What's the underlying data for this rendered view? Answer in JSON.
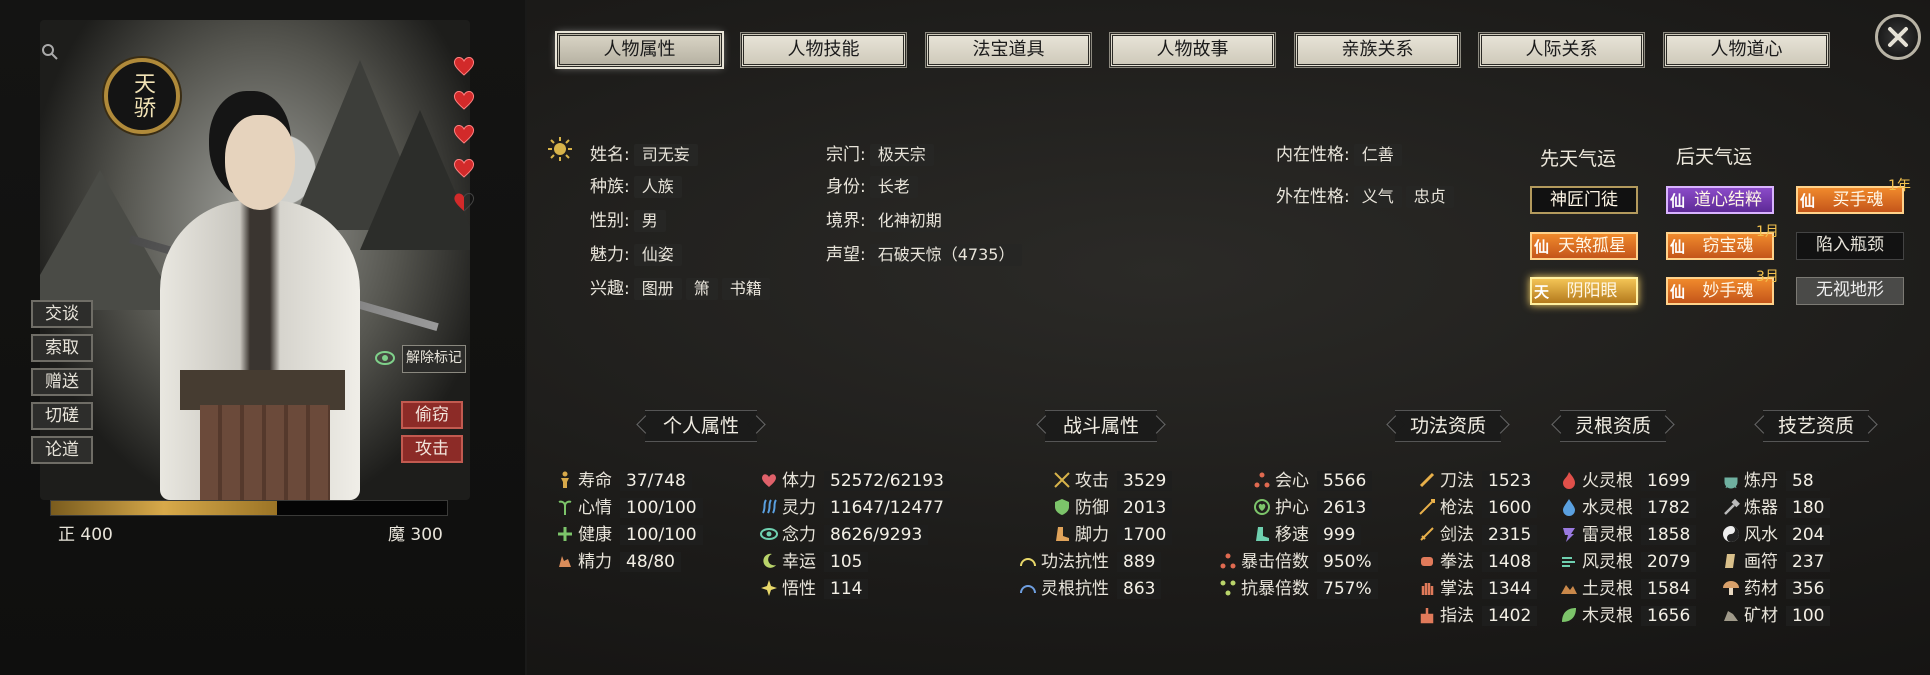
{
  "tabs": [
    "人物属性",
    "人物技能",
    "法宝道具",
    "人物故事",
    "亲族关系",
    "人际关系",
    "人物道心"
  ],
  "portrait": {
    "badge": "天骄",
    "side_buttons": [
      "交谈",
      "索取",
      "赠送",
      "切磋",
      "论道"
    ],
    "red_buttons": [
      "偷窃",
      "攻击"
    ],
    "unmark": "解除标记",
    "alignment": {
      "righteous": "正 400",
      "demonic": "魔 300",
      "righteous_value": 400,
      "demonic_value": 300
    }
  },
  "info": {
    "name_label": "姓名:",
    "name": "司无妄",
    "race_label": "种族:",
    "race": "人族",
    "gender_label": "性别:",
    "gender": "男",
    "charm_label": "魅力:",
    "charm": "仙姿",
    "hobby_label": "兴趣:",
    "hobbies": [
      "图册",
      "箫",
      "书籍"
    ],
    "sect_label": "宗门:",
    "sect": "极天宗",
    "identity_label": "身份:",
    "identity": "长老",
    "realm_label": "境界:",
    "realm": "化神初期",
    "fame_label": "声望:",
    "fame": "石破天惊（4735）",
    "inner_label": "内在性格:",
    "inner": "仁善",
    "outer_label": "外在性格:",
    "outer": [
      "义气",
      "忠贞"
    ]
  },
  "fortune": {
    "innate_head": "先天气运",
    "acquired_head": "后天气运",
    "innate": [
      "神匠门徒",
      "天煞孤星",
      "阴阳眼"
    ],
    "acquired": [
      "道心结粹",
      "窃宝魂",
      "妙手魂"
    ],
    "acquired_extra": [
      "买手魂",
      "陷入瓶颈",
      "无视地形"
    ],
    "tag_xian": "仙",
    "tag_tian": "天",
    "times": [
      "1年",
      "1月",
      "3月"
    ]
  },
  "sections": {
    "personal": "个人属性",
    "combat": "战斗属性",
    "technique": "功法资质",
    "root": "灵根资质",
    "skill": "技艺资质"
  },
  "personal_stats": [
    {
      "label": "寿命",
      "value": "37/748"
    },
    {
      "label": "心情",
      "value": "100/100"
    },
    {
      "label": "健康",
      "value": "100/100"
    },
    {
      "label": "精力",
      "value": "48/80"
    }
  ],
  "vital_stats": [
    {
      "label": "体力",
      "value": "52572/62193"
    },
    {
      "label": "灵力",
      "value": "11647/12477"
    },
    {
      "label": "念力",
      "value": "8626/9293"
    },
    {
      "label": "幸运",
      "value": "105"
    },
    {
      "label": "悟性",
      "value": "114"
    }
  ],
  "combat_stats": [
    {
      "label": "攻击",
      "value": "3529"
    },
    {
      "label": "防御",
      "value": "2013"
    },
    {
      "label": "脚力",
      "value": "1700"
    },
    {
      "label": "功法抗性",
      "value": "889"
    },
    {
      "label": "灵根抗性",
      "value": "863"
    }
  ],
  "combat_stats2": [
    {
      "label": "会心",
      "value": "5566"
    },
    {
      "label": "护心",
      "value": "2613"
    },
    {
      "label": "移速",
      "value": "999"
    },
    {
      "label": "暴击倍数",
      "value": "950%"
    },
    {
      "label": "抗暴倍数",
      "value": "757%"
    }
  ],
  "technique_stats": [
    {
      "label": "刀法",
      "value": "1523"
    },
    {
      "label": "枪法",
      "value": "1600"
    },
    {
      "label": "剑法",
      "value": "2315"
    },
    {
      "label": "拳法",
      "value": "1408"
    },
    {
      "label": "掌法",
      "value": "1344"
    },
    {
      "label": "指法",
      "value": "1402"
    }
  ],
  "root_stats": [
    {
      "label": "火灵根",
      "value": "1699"
    },
    {
      "label": "水灵根",
      "value": "1782"
    },
    {
      "label": "雷灵根",
      "value": "1858"
    },
    {
      "label": "风灵根",
      "value": "2079"
    },
    {
      "label": "土灵根",
      "value": "1584"
    },
    {
      "label": "木灵根",
      "value": "1656"
    }
  ],
  "skill_stats": [
    {
      "label": "炼丹",
      "value": "58"
    },
    {
      "label": "炼器",
      "value": "180"
    },
    {
      "label": "风水",
      "value": "204"
    },
    {
      "label": "画符",
      "value": "237"
    },
    {
      "label": "药材",
      "value": "356"
    },
    {
      "label": "矿材",
      "value": "100"
    }
  ],
  "colors": {
    "accent_gold": "#d7a94a",
    "orange_fortune": "#f08a2c",
    "purple_fortune": "#8b4bc8",
    "red_button": "#8c2b27"
  }
}
